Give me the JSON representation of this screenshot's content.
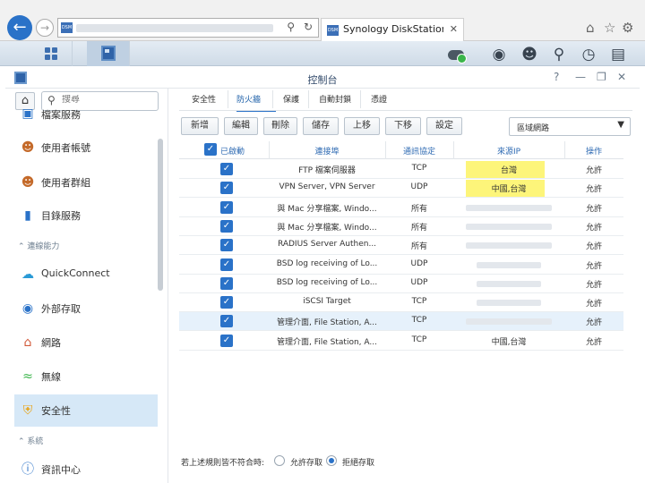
{
  "browser": {
    "tab_title": "Synology DiskStation - Sy...",
    "favicon_text": "DSM",
    "icons": [
      "back-arrow-icon",
      "forward-arrow-icon",
      "search-icon",
      "refresh-icon",
      "close-icon",
      "home-icon",
      "star-icon",
      "gear-icon"
    ]
  },
  "window": {
    "title": "控制台"
  },
  "sidebar": {
    "search_placeholder": "搜尋",
    "items": [
      {
        "label": "檔案服務",
        "icon": "file-services-icon"
      },
      {
        "label": "使用者帳號",
        "icon": "user-icon"
      },
      {
        "label": "使用者群組",
        "icon": "group-icon"
      },
      {
        "label": "目錄服務",
        "icon": "directory-icon"
      },
      {
        "label": "QuickConnect",
        "icon": "quickconnect-icon"
      },
      {
        "label": "外部存取",
        "icon": "globe-icon"
      },
      {
        "label": "網路",
        "icon": "network-icon"
      },
      {
        "label": "無線",
        "icon": "wifi-icon"
      },
      {
        "label": "安全性",
        "icon": "shield-icon"
      },
      {
        "label": "資訊中心",
        "icon": "info-icon"
      }
    ],
    "sections": [
      "連線能力",
      "系統"
    ]
  },
  "tabs": [
    "安全性",
    "防火牆",
    "保護",
    "自動封鎖",
    "憑證"
  ],
  "toolbar": {
    "buttons": [
      "新增",
      "編輯",
      "刪除",
      "儲存",
      "上移",
      "下移",
      "設定"
    ],
    "select_value": "區域網路"
  },
  "grid": {
    "headers": [
      "已啟動",
      "連接埠",
      "通訊協定",
      "來源IP",
      "操作"
    ],
    "rows": [
      {
        "port": "FTP 檔案伺服器",
        "protocol": "TCP",
        "source": "台灣",
        "action": "允許",
        "highlight": true
      },
      {
        "port": "VPN Server, VPN Server",
        "protocol": "UDP",
        "source": "中國,台灣",
        "action": "允許",
        "highlight": true
      },
      {
        "port": "與 Mac 分享檔案, Windo...",
        "protocol": "所有",
        "source": "",
        "action": "允許"
      },
      {
        "port": "與 Mac 分享檔案, Windo...",
        "protocol": "所有",
        "source": "",
        "action": "允許"
      },
      {
        "port": "RADIUS Server Authen...",
        "protocol": "所有",
        "source": "",
        "action": "允許"
      },
      {
        "port": "BSD log receiving of Lo...",
        "protocol": "UDP",
        "source": "",
        "action": "允許"
      },
      {
        "port": "BSD log receiving of Lo...",
        "protocol": "UDP",
        "source": "",
        "action": "允許"
      },
      {
        "port": "iSCSI Target",
        "protocol": "TCP",
        "source": "",
        "action": "允許"
      },
      {
        "port": "管理介面, File Station, A...",
        "protocol": "TCP",
        "source": "",
        "action": "允許",
        "selected": true
      },
      {
        "port": "管理介面, File Station, A...",
        "protocol": "TCP",
        "source": "中國,台灣",
        "action": "允許"
      }
    ]
  },
  "footer": {
    "text": "若上述規則皆不符合時:",
    "allow_label": "允許存取",
    "deny_label": "拒絕存取"
  }
}
